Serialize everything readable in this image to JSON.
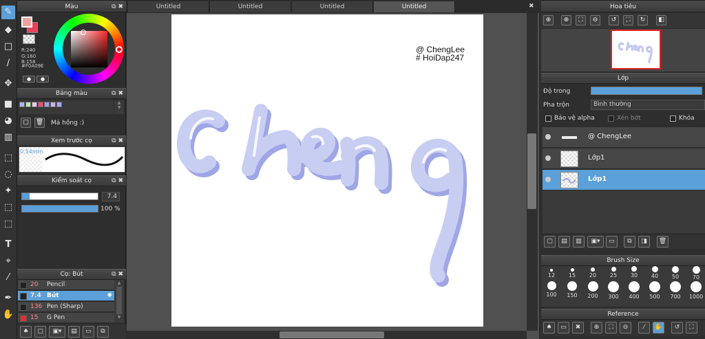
{
  "colors": {
    "accent": "#5ba0d8",
    "foreground_color": "#F0A09E",
    "canvas_stroke": "#c8cdf2",
    "canvas_shadow": "#9ea6e6"
  },
  "color_panel": {
    "title": "Màu",
    "r": "R:240",
    "g": "G:160",
    "b": "B:158",
    "hex": "#F0A09E"
  },
  "palette_panel": {
    "title": "Bảng màu",
    "swatches": [
      "#b4b4f0",
      "#b4f0b4",
      "#f0c8e8",
      "#f05070",
      "#a0a0f0",
      "#c8b4f0",
      "#a8a8f8"
    ],
    "selected_name": "Má hồng :)"
  },
  "brush_preview": {
    "title": "Xem trước cọ",
    "size_label": "0.54mm"
  },
  "brush_control": {
    "title": "Kiểm soát cọ",
    "size_value": "7.4",
    "opacity_value": "100 %",
    "size_fraction": 0.1,
    "opacity_fraction": 1.0
  },
  "brush_list": {
    "title": "Cọ: Bút",
    "items": [
      {
        "size": "20",
        "name": "Pencil",
        "color": "#222222",
        "selected": false
      },
      {
        "size": "7.4",
        "name": "Bút",
        "color": "#222222",
        "selected": true
      },
      {
        "size": "136",
        "name": "Pen (Sharp)",
        "color": "#222222",
        "selected": false
      },
      {
        "size": "15",
        "name": "G Pen",
        "color": "#e03030",
        "selected": false
      }
    ]
  },
  "tabs": [
    "Untitled",
    "Untitled",
    "Untitled",
    "Untitled"
  ],
  "canvas": {
    "watermark_line1": "@ ChengLee",
    "watermark_line2": "# HoiDap247",
    "drawn_text": "cheng"
  },
  "navigator": {
    "title": "Hoa tiêu"
  },
  "layers_panel": {
    "title": "Lớp",
    "opacity_label": "Độ trong",
    "blend_label": "Pha trộn",
    "blend_value": "Bình thường",
    "protect_alpha": "Bảo vệ alpha",
    "clipping": "Xén bớt",
    "lock": "Khóa",
    "layers": [
      {
        "name": "@ ChengLee",
        "selected": false
      },
      {
        "name": "Lớp1",
        "selected": false
      },
      {
        "name": "Lớp1",
        "selected": true
      }
    ]
  },
  "brush_size_panel": {
    "title": "Brush Size",
    "row1": [
      "12",
      "15",
      "20",
      "25",
      "30",
      "40",
      "50",
      "70"
    ],
    "row2": [
      "100",
      "150",
      "200",
      "300",
      "400",
      "500",
      "700",
      "1000"
    ]
  },
  "reference_panel": {
    "title": "Reference"
  }
}
